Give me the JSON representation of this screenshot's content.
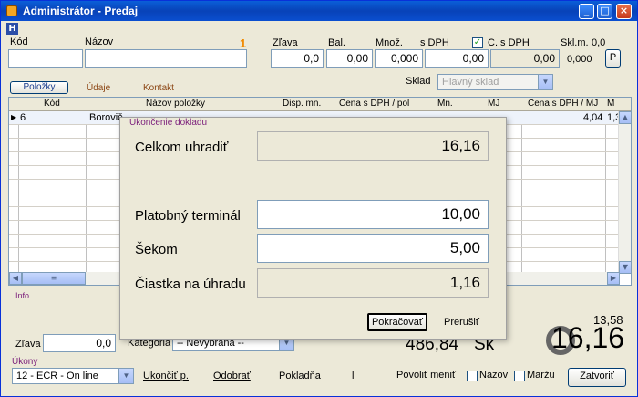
{
  "window": {
    "title": "Administrátor - Predaj",
    "menu_icon": "H"
  },
  "header": {
    "labels": {
      "kod": "Kód",
      "nazov": "Názov",
      "count": "1",
      "zlava": "Zľava",
      "bal": "Bal.",
      "mnoz": "Množ.",
      "sdph": "s DPH",
      "csdph": "C. s DPH",
      "sklm": "Skl.m."
    },
    "values": {
      "zlava": "0,0",
      "bal": "0,00",
      "mnoz": "0,000",
      "sdph": "0,00",
      "csdph": "0,00",
      "sklm": "0,0",
      "sklm2": "0,000"
    },
    "p_button": "P"
  },
  "tabs": {
    "polozky": "Položky",
    "udaje": "Údaje",
    "kontakt": "Kontakt"
  },
  "sklad": {
    "label": "Sklad",
    "value": "Hlavný sklad"
  },
  "grid": {
    "columns": [
      "Kód",
      "Názov položky",
      "Disp. mn.",
      "Cena s DPH / pol",
      "Mn.",
      "MJ",
      "Cena s DPH / MJ",
      "M"
    ],
    "row": {
      "kod": "6",
      "nazov": "Borovič",
      "price": "4,04",
      "m": "1,3"
    }
  },
  "info_label": "Info",
  "dialog": {
    "title": "Ukončenie dokladu",
    "celkom_label": "Celkom uhradiť",
    "celkom_value": "16,16",
    "terminal_label": "Platobný terminál",
    "terminal_value": "10,00",
    "sekom_label": "Šekom",
    "sekom_value": "5,00",
    "ciastka_label": "Čiastka na úhradu",
    "ciastka_value": "1,16",
    "continue_button": "Pokračovať",
    "cancel_button": "Prerušiť"
  },
  "footer": {
    "zlava_label": "Zľava",
    "zlava_value": "0,0",
    "kategoria_label": "Kategoria",
    "kategoria_value": "-- Nevybraná --",
    "total": "486,84",
    "currency": "Sk",
    "small_total": "13,58",
    "big_total": "16,16",
    "ukony_label": "Úkony",
    "ukony_value": "12 - ECR - On line",
    "ukoncit": "Ukončiť p.",
    "odobrat": "Odobrať",
    "pokladna": "Pokladňa",
    "sep": "l",
    "povolit": "Povoliť meniť",
    "nazov": "Názov",
    "marzu": "Maržu",
    "zatvorit": "Zatvoriť"
  }
}
